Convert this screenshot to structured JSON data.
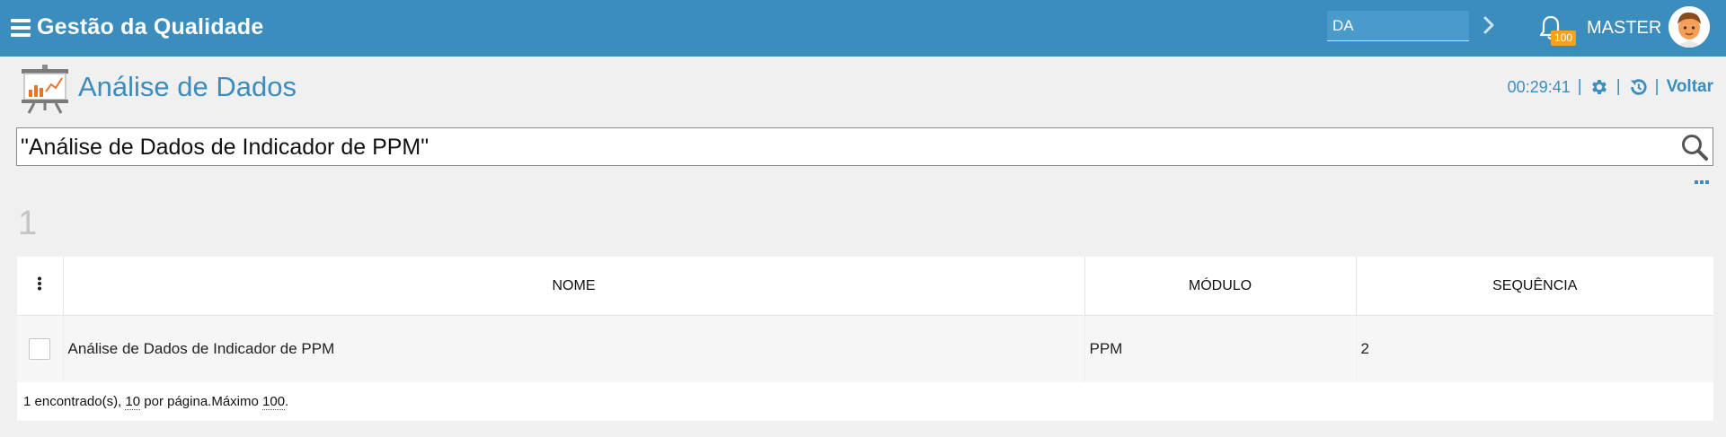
{
  "app": {
    "title": "Gestão da Qualidade"
  },
  "topbar": {
    "context_value": "DA",
    "notifications_count": "100",
    "user_name": "MASTER"
  },
  "page": {
    "title": "Análise de Dados",
    "timer": "00:29:41",
    "back_label": "Voltar",
    "separator": "|"
  },
  "search": {
    "value": "\"Análise de Dados de Indicador de PPM\""
  },
  "results": {
    "count": "1"
  },
  "table": {
    "columns": [
      "NOME",
      "MÓDULO",
      "SEQUÊNCIA"
    ],
    "rows": [
      {
        "nome": "Análise de Dados de Indicador de PPM",
        "modulo": "PPM",
        "sequencia": "2"
      }
    ],
    "footer": {
      "found_text": "1 encontrado(s),",
      "per_page_value": "10",
      "per_page_text": "por página.Máximo",
      "max_value": "100",
      "end": "."
    }
  },
  "icons": {
    "menu": "hamburger-icon",
    "next": "chevron-right-icon",
    "bell": "bell-icon",
    "avatar": "avatar-icon",
    "page": "presentation-chart-icon",
    "settings": "gear-icon",
    "history": "history-icon",
    "search": "search-icon",
    "more": "more-dots-icon",
    "column_menu": "kebab-icon"
  },
  "colors": {
    "topbar": "#3b8dbd",
    "accent": "#3b8dbd",
    "badge": "#f4a31b",
    "background": "#f0f0f0"
  }
}
